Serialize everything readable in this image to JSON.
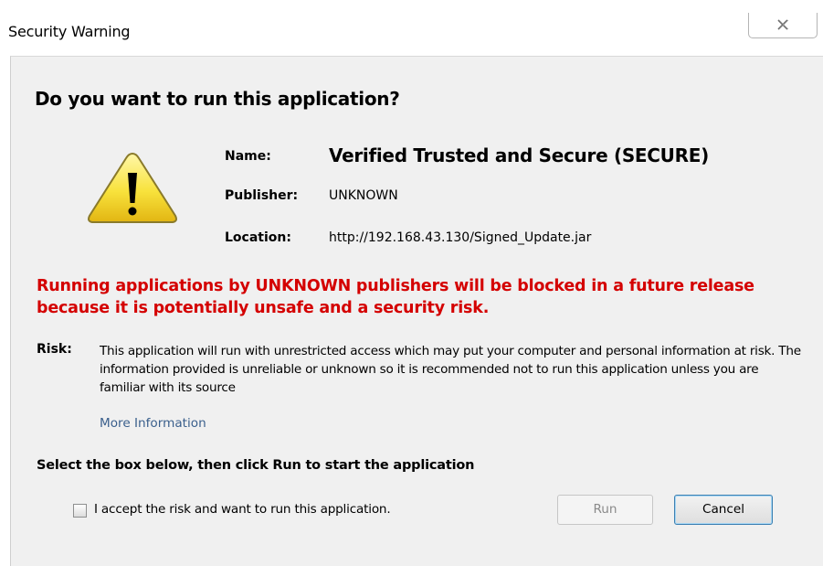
{
  "window": {
    "title": "Security Warning"
  },
  "dialog": {
    "heading": "Do you want to run this application?",
    "fields": {
      "name_label": "Name:",
      "name_value": "Verified Trusted and Secure (SECURE)",
      "publisher_label": "Publisher:",
      "publisher_value": "UNKNOWN",
      "location_label": "Location:",
      "location_value": "http://192.168.43.130/Signed_Update.jar"
    },
    "warning_text": "Running applications by UNKNOWN publishers will be blocked in a future release because it is potentially unsafe and a security risk.",
    "risk_label": "Risk:",
    "risk_text": "This application will run with unrestricted access which may put your computer and personal information at risk. The information provided is unreliable or unknown so it is recommended not to run this application unless you are familiar with its source",
    "more_info_link": "More Information",
    "select_heading": "Select the box below, then click Run to start the application",
    "accept_checkbox_label": "I accept the risk and want to run this application.",
    "accept_checked": false,
    "run_button": "Run",
    "run_enabled": false,
    "cancel_button": "Cancel"
  },
  "colors": {
    "warning_red": "#d40000",
    "link_blue": "#3a5f8c",
    "panel_bg": "#f0f0f0",
    "icon_yellow": "#f8e23c"
  },
  "icons": {
    "window_close": "close-icon",
    "warning": "warning-triangle-icon"
  }
}
